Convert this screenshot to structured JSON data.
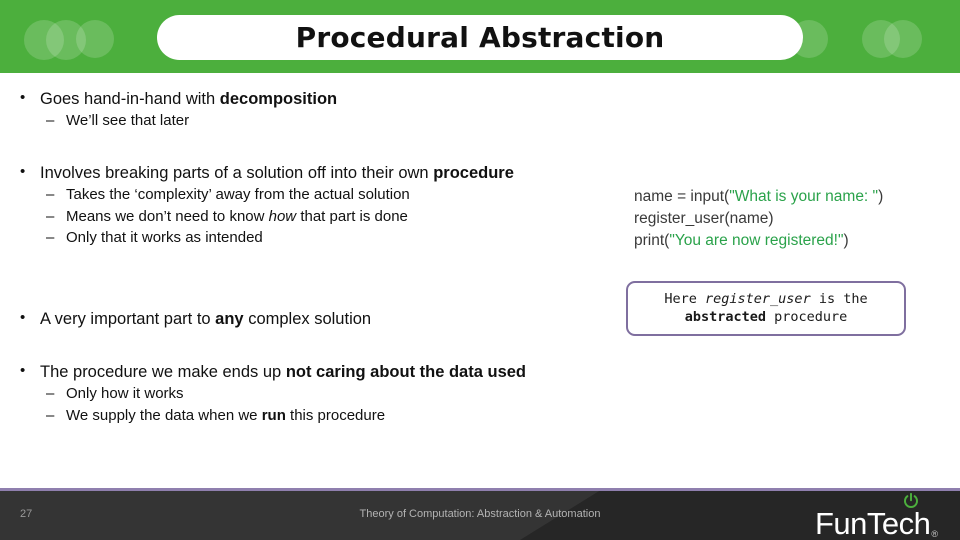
{
  "header": {
    "title": "Procedural Abstraction",
    "bg_color": "#4caf3d",
    "pill_color": "#ffffff",
    "decorations": [
      "circle",
      "circle",
      "circle",
      "circle",
      "circle",
      "circle"
    ]
  },
  "body": {
    "groups": [
      {
        "main": {
          "pre": "Goes hand-in-hand with ",
          "bold": "decomposition",
          "post": ""
        },
        "subs": [
          {
            "pre": "We’ll see that later",
            "italic": "",
            "post": ""
          }
        ]
      },
      {
        "main": {
          "pre": "Involves breaking parts of a solution off into their own ",
          "bold": "procedure",
          "post": ""
        },
        "subs": [
          {
            "pre": "Takes the ‘complexity’ away from the actual solution",
            "italic": "",
            "post": ""
          },
          {
            "pre": "Means we don’t need to know ",
            "italic": "how",
            "post": " that part is done"
          },
          {
            "pre": "Only that it works as intended",
            "italic": "",
            "post": ""
          }
        ]
      },
      {
        "main": {
          "pre": "A very important part to ",
          "bold": "any",
          "post": " complex solution"
        },
        "subs": []
      },
      {
        "main": {
          "pre": "The procedure we make ends up ",
          "bold": "not caring about the data used",
          "post": ""
        },
        "subs": [
          {
            "pre": "Only how it works",
            "italic": "",
            "post": ""
          },
          {
            "pre": "We supply the data when we ",
            "bold": "run",
            "post": " this procedure"
          }
        ]
      }
    ]
  },
  "code": {
    "string_color": "#2aa24a",
    "lines": [
      {
        "code_pre": "name = input(",
        "string": "\"What is your name: \"",
        "code_post": ")"
      },
      {
        "code_pre": "register_user(name)",
        "string": "",
        "code_post": ""
      },
      {
        "code_pre": "print(",
        "string": "\"You are now registered!\"",
        "code_post": ")"
      }
    ]
  },
  "callout": {
    "border_color": "#7f6f9f",
    "line1_pre": "Here ",
    "line1_italic": "register_user",
    "line1_post": " is the",
    "line2_bold": "abstracted",
    "line2_post": " procedure"
  },
  "footer": {
    "page_number": "27",
    "title": "Theory of Computation: Abstraction & Automation",
    "logo_text": "FunTech",
    "logo_registered": "®",
    "power_icon_color": "#4caf3d",
    "bar_color": "#343434",
    "accent_color": "#8f7fae"
  }
}
